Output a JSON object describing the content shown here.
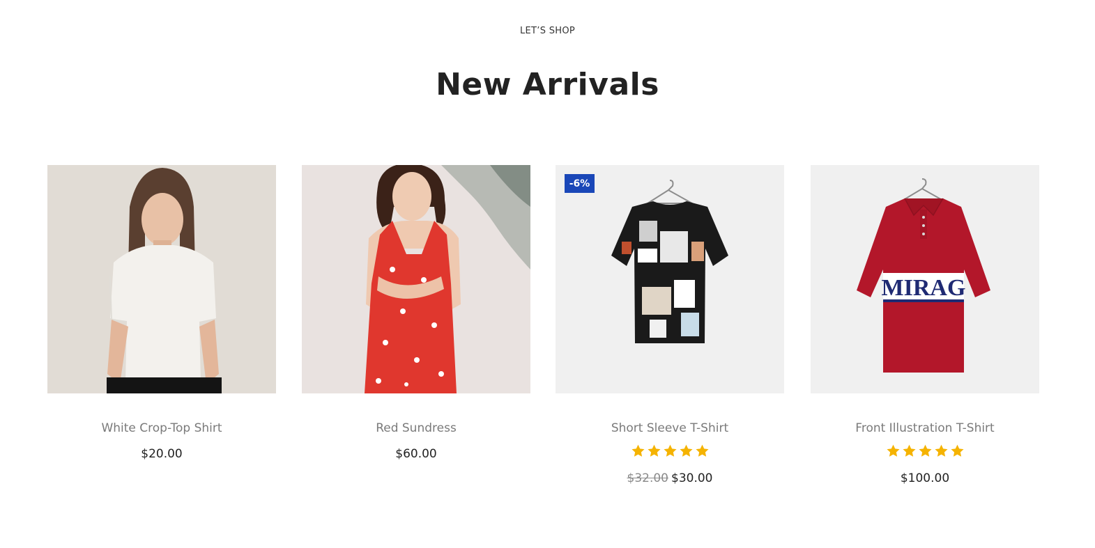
{
  "section": {
    "kicker": "LET’S SHOP",
    "title": "New Arrivals"
  },
  "colors": {
    "badge": "#1a47b8",
    "star": "#f5b301",
    "heading": "#222222",
    "product_name": "#7a7a7a"
  },
  "products": [
    {
      "name": "White Crop-Top Shirt",
      "price": "$20.00",
      "image": "woman-white-crop-top-photo"
    },
    {
      "name": "Red Sundress",
      "price": "$60.00",
      "image": "woman-red-sundress-photo"
    },
    {
      "name": "Short Sleeve T-Shirt",
      "badge": "-6%",
      "rating": 5,
      "old_price": "$32.00",
      "price": "$30.00",
      "image": "printed-tshirt-on-hanger"
    },
    {
      "name": "Front Illustration T-Shirt",
      "rating": 5,
      "price": "$100.00",
      "image": "red-polo-mirag-on-hanger",
      "shirt_text": "MIRAG"
    }
  ]
}
